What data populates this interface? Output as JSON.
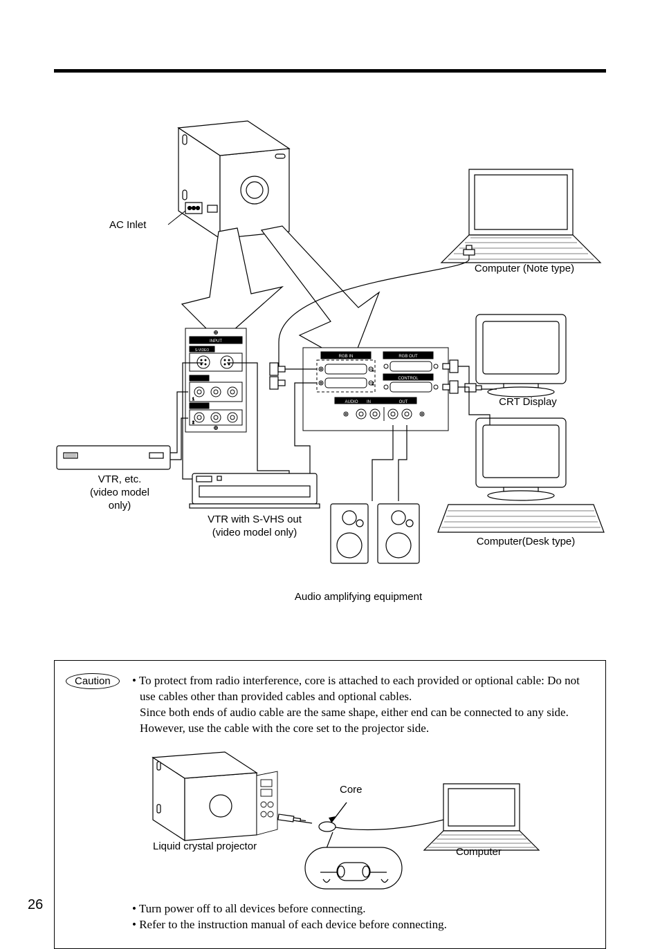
{
  "labels": {
    "ac_inlet": "AC Inlet",
    "computer_note": "Computer (Note type)",
    "crt_display": "CRT Display",
    "computer_desk": "Computer(Desk type)",
    "vtr_etc": "VTR, etc.",
    "vtr_note": "(video model only)",
    "vtr_svhs": "VTR with S-VHS out",
    "vtr_svhs_note": "(video model only)",
    "audio_amp": "Audio amplifying equipment",
    "panel": {
      "input": "INPUT",
      "svideo": "S-VIDEO",
      "video_l": "VIDEO",
      "video_r": "L-AUDIO-R",
      "rgb_in": "RGB IN",
      "rgb_out": "RGB OUT",
      "control": "CONTROL",
      "audio": "AUDIO",
      "in": "IN",
      "out": "OUT"
    }
  },
  "caution": {
    "badge": "Caution",
    "p1": "• To protect from radio interference, core is attached to each provided or optional cable:  Do not use cables other than provided cables and optional cables.",
    "p2": "Since both ends of audio cable are the same shape, either end can be connected to any side. However, use the cable with the core set to the projector side.",
    "core": "Core",
    "lcp": "Liquid crystal projector",
    "computer": "Computer",
    "b1": "• Turn power off to all devices before connecting.",
    "b2": "• Refer to the instruction manual of each device before connecting."
  },
  "page": "26"
}
